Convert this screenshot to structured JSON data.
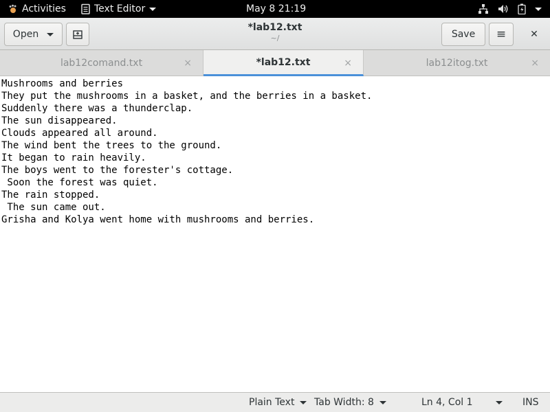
{
  "topbar": {
    "activities_label": "Activities",
    "app_label": "Text Editor",
    "clock": "May 8  21:19"
  },
  "headerbar": {
    "open_label": "Open",
    "title": "*lab12.txt",
    "subtitle": "~/",
    "save_label": "Save",
    "close_glyph": "✕",
    "menu_glyph": "≡"
  },
  "tabs": [
    {
      "label": "lab12comand.txt",
      "close": "×"
    },
    {
      "label": "*lab12.txt",
      "close": "×"
    },
    {
      "label": "lab12itog.txt",
      "close": "×"
    }
  ],
  "editor": {
    "lines": [
      "Mushrooms and berries",
      "They put the mushrooms in a basket, and the berries in a basket.",
      "Suddenly there was a thunderclap.",
      "The sun disappeared.",
      "Clouds appeared all around.",
      "The wind bent the trees to the ground.",
      "It began to rain heavily.",
      "The boys went to the forester's cottage.",
      " Soon the forest was quiet.",
      "The rain stopped.",
      " The sun came out.",
      "Grisha and Kolya went home with mushrooms and berries."
    ]
  },
  "statusbar": {
    "language": "Plain Text",
    "tab_width": "Tab Width: 8",
    "position": "Ln 4, Col 1",
    "mode": "INS"
  },
  "colors": {
    "topbar_bg": "#000000",
    "active_tab_underline": "#4a90d9"
  }
}
